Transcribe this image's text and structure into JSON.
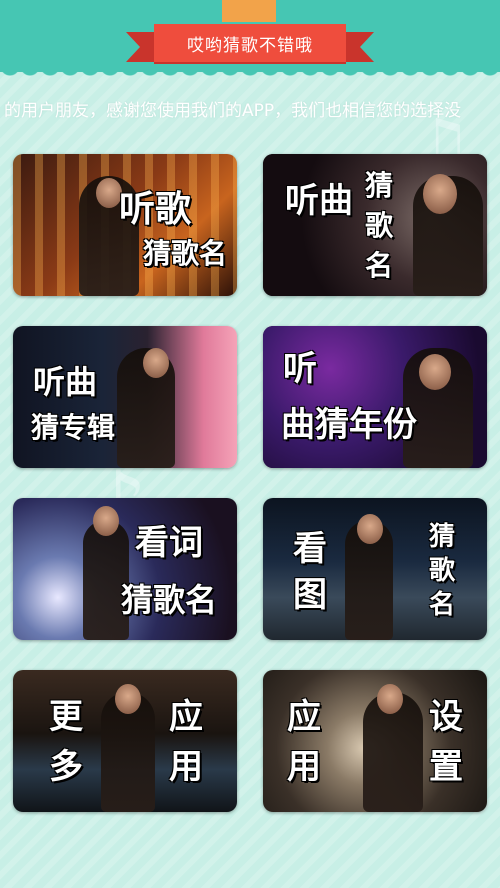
{
  "header": {
    "title": "哎哟猜歌不错哦"
  },
  "marquee": {
    "text": "的用户朋友，感谢您使用我们的APP，我们也相信您的选择没"
  },
  "menu": [
    {
      "id": "listen-song-guess-name",
      "lines": [
        "听歌",
        "猜歌名"
      ]
    },
    {
      "id": "listen-tune-guess-name",
      "lines": [
        "听曲",
        "猜",
        "歌",
        "名"
      ]
    },
    {
      "id": "listen-tune-guess-album",
      "lines": [
        "听曲",
        "猜专辑"
      ]
    },
    {
      "id": "listen-tune-guess-year",
      "lines": [
        "听",
        "曲猜年份"
      ]
    },
    {
      "id": "read-lyrics-guess-name",
      "lines": [
        "看词",
        "猜歌名"
      ]
    },
    {
      "id": "view-image-guess-name",
      "lines": [
        "看",
        "图",
        "猜",
        "歌",
        "名"
      ]
    },
    {
      "id": "more-apps",
      "lines": [
        "更",
        "多",
        "应",
        "用"
      ]
    },
    {
      "id": "settings",
      "lines": [
        "应",
        "用",
        "设",
        "置"
      ]
    }
  ],
  "colors": {
    "top_band": "#46c6b3",
    "ribbon": "#ef4d3d",
    "background": "#c8efe6"
  }
}
